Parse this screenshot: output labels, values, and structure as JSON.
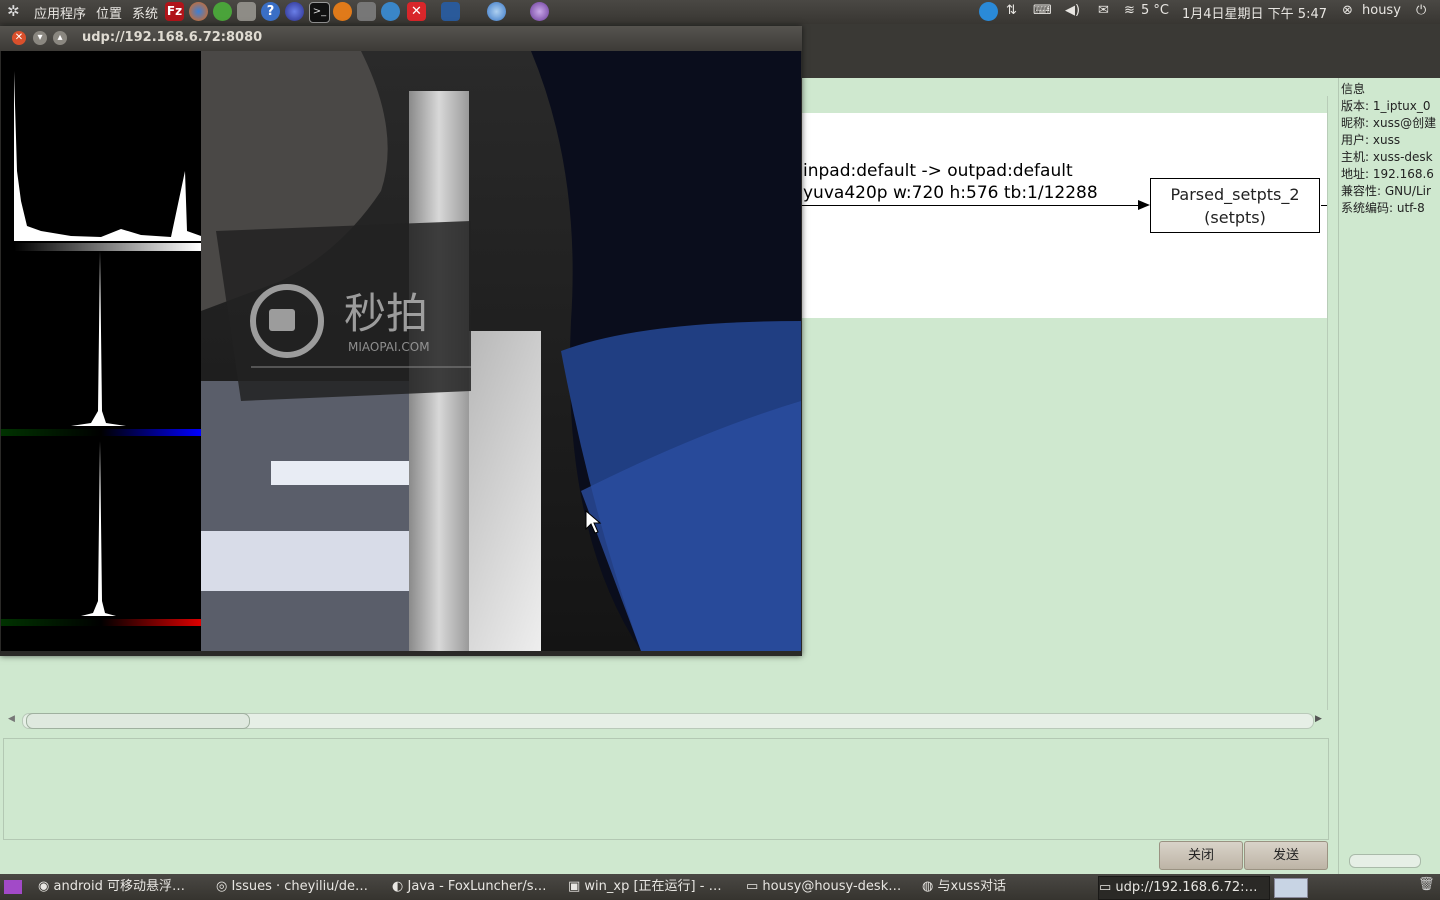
{
  "top_panel": {
    "menus": [
      "应用程序",
      "位置",
      "系统"
    ],
    "weather": "5 °C",
    "clock": "1月4日星期日 下午 5:47",
    "user": "housy"
  },
  "video_window": {
    "title": "udp://192.168.6.72:8080",
    "watermark_cn": "秒拍",
    "watermark_en": "MIAOPAI.COM"
  },
  "graph": {
    "edge_line1": "inpad:default -> outpad:default",
    "edge_line2": "yuva420p w:720 h:576 tb:1/12288",
    "node_line1": "Parsed_setpts_2",
    "node_line2": "(setpts)"
  },
  "info_panel": {
    "header": "信息",
    "lines": [
      "版本: 1_iptux_0",
      "昵称: xuss@创建",
      "用户: xuss",
      "主机: xuss-desk",
      "地址: 192.168.6",
      "兼容性: GNU/Lir",
      "系统编码: utf-8"
    ]
  },
  "buttons": {
    "close": "关闭",
    "send": "发送"
  },
  "taskbar": {
    "items": [
      "android 可移动悬浮…",
      "Issues · cheyiliu/de…",
      "Java - FoxLuncher/s…",
      "win_xp [正在运行] - …",
      "housy@housy-desk…",
      "与xuss对话",
      "udp://192.168.6.72:…"
    ]
  },
  "colors": {
    "chat_bg": "#cfe8cf",
    "panel": "#3d3b37"
  }
}
